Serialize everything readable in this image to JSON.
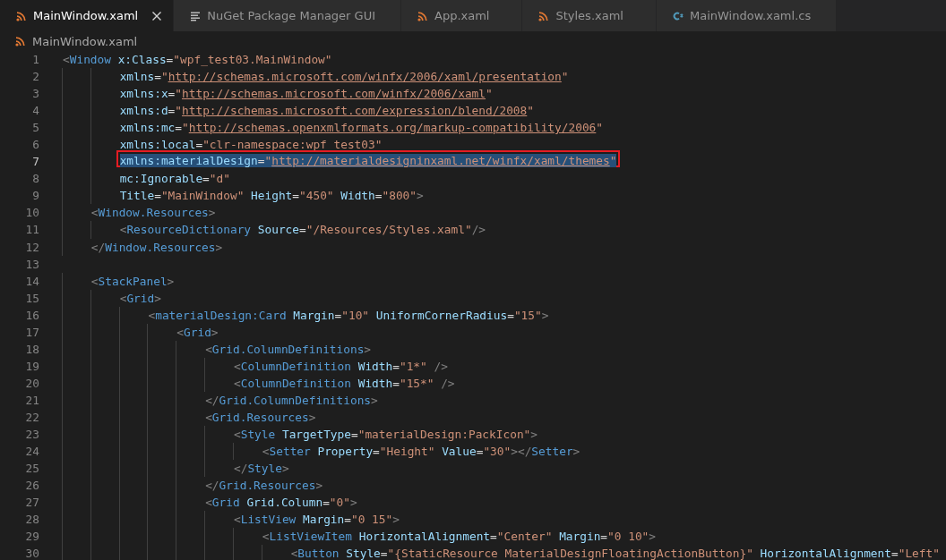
{
  "tabs": [
    {
      "label": "MainWindow.xaml",
      "kind": "xaml",
      "selected": true
    },
    {
      "label": "NuGet Package Manager GUI",
      "kind": "doc",
      "selected": false
    },
    {
      "label": "App.xaml",
      "kind": "xaml",
      "selected": false
    },
    {
      "label": "Styles.xaml",
      "kind": "xaml",
      "selected": false
    },
    {
      "label": "MainWindow.xaml.cs",
      "kind": "cs",
      "selected": false
    }
  ],
  "breadcrumb": {
    "label": "MainWindow.xaml",
    "kind": "xaml"
  },
  "lines": [
    {
      "number": "1",
      "selected": false,
      "tokens": [
        {
          "kind": "p",
          "text": "<"
        },
        {
          "kind": "tag",
          "text": "Window"
        },
        {
          "kind": "attr",
          "text": " x:Class"
        },
        {
          "kind": "eq",
          "text": "="
        },
        {
          "kind": "str",
          "text": "\"wpf_test03.MainWindow\""
        }
      ]
    },
    {
      "number": "2",
      "selected": false,
      "tokens": [
        {
          "kind": "attr",
          "text": "        xmlns"
        },
        {
          "kind": "eq",
          "text": "="
        },
        {
          "kind": "str",
          "text": "\""
        },
        {
          "kind": "link",
          "text": "http://schemas.microsoft.com/winfx/2006/xaml/presentation"
        },
        {
          "kind": "str",
          "text": "\""
        }
      ]
    },
    {
      "number": "3",
      "selected": false,
      "tokens": [
        {
          "kind": "attr",
          "text": "        xmlns:x"
        },
        {
          "kind": "eq",
          "text": "="
        },
        {
          "kind": "str",
          "text": "\""
        },
        {
          "kind": "link",
          "text": "http://schemas.microsoft.com/winfx/2006/xaml"
        },
        {
          "kind": "str",
          "text": "\""
        }
      ]
    },
    {
      "number": "4",
      "selected": false,
      "tokens": [
        {
          "kind": "attr",
          "text": "        xmlns:d"
        },
        {
          "kind": "eq",
          "text": "="
        },
        {
          "kind": "str",
          "text": "\""
        },
        {
          "kind": "link",
          "text": "http://schemas.microsoft.com/expression/blend/2008"
        },
        {
          "kind": "str",
          "text": "\""
        }
      ]
    },
    {
      "number": "5",
      "selected": false,
      "tokens": [
        {
          "kind": "attr",
          "text": "        xmlns:mc"
        },
        {
          "kind": "eq",
          "text": "="
        },
        {
          "kind": "str",
          "text": "\""
        },
        {
          "kind": "link",
          "text": "http://schemas.openxmlformats.org/markup-compatibility/2006"
        },
        {
          "kind": "str",
          "text": "\""
        }
      ]
    },
    {
      "number": "6",
      "selected": false,
      "tokens": [
        {
          "kind": "attr",
          "text": "        xmlns:local"
        },
        {
          "kind": "eq",
          "text": "="
        },
        {
          "kind": "str",
          "text": "\"clr-namespace:wpf_test03\""
        }
      ]
    },
    {
      "number": "7",
      "selected": true,
      "boxed": true,
      "tokens": [
        {
          "kind": "attr",
          "text": "        xmlns:materialDesign"
        },
        {
          "kind": "eq",
          "text": "="
        },
        {
          "kind": "str",
          "text": "\""
        },
        {
          "kind": "link",
          "text": "http://materialdesigninxaml.net/winfx/xaml/themes"
        },
        {
          "kind": "str",
          "text": "\""
        }
      ]
    },
    {
      "number": "8",
      "selected": false,
      "tokens": [
        {
          "kind": "attr",
          "text": "        mc:Ignorable"
        },
        {
          "kind": "eq",
          "text": "="
        },
        {
          "kind": "str",
          "text": "\"d\""
        }
      ]
    },
    {
      "number": "9",
      "selected": false,
      "tokens": [
        {
          "kind": "attr",
          "text": "        Title"
        },
        {
          "kind": "eq",
          "text": "="
        },
        {
          "kind": "str",
          "text": "\"MainWindow\""
        },
        {
          "kind": "attr",
          "text": " Height"
        },
        {
          "kind": "eq",
          "text": "="
        },
        {
          "kind": "str",
          "text": "\"450\""
        },
        {
          "kind": "attr",
          "text": " Width"
        },
        {
          "kind": "eq",
          "text": "="
        },
        {
          "kind": "str",
          "text": "\"800\""
        },
        {
          "kind": "p",
          "text": ">"
        }
      ]
    },
    {
      "number": "10",
      "selected": false,
      "tokens": [
        {
          "kind": "p",
          "text": "    <"
        },
        {
          "kind": "tag",
          "text": "Window.Resources"
        },
        {
          "kind": "p",
          "text": ">"
        }
      ]
    },
    {
      "number": "11",
      "selected": false,
      "tokens": [
        {
          "kind": "p",
          "text": "        <"
        },
        {
          "kind": "tag",
          "text": "ResourceDictionary"
        },
        {
          "kind": "attr",
          "text": " Source"
        },
        {
          "kind": "eq",
          "text": "="
        },
        {
          "kind": "str",
          "text": "\"/Resources/Styles.xaml\""
        },
        {
          "kind": "p",
          "text": "/>"
        }
      ]
    },
    {
      "number": "12",
      "selected": false,
      "tokens": [
        {
          "kind": "p",
          "text": "    </"
        },
        {
          "kind": "tag",
          "text": "Window.Resources"
        },
        {
          "kind": "p",
          "text": ">"
        }
      ]
    },
    {
      "number": "13",
      "selected": false
    },
    {
      "number": "14",
      "selected": false,
      "tokens": [
        {
          "kind": "p",
          "text": "    <"
        },
        {
          "kind": "tag",
          "text": "StackPanel"
        },
        {
          "kind": "p",
          "text": ">"
        }
      ]
    },
    {
      "number": "15",
      "selected": false,
      "tokens": [
        {
          "kind": "p",
          "text": "        <"
        },
        {
          "kind": "tag",
          "text": "Grid"
        },
        {
          "kind": "p",
          "text": ">"
        }
      ]
    },
    {
      "number": "16",
      "selected": false,
      "tokens": [
        {
          "kind": "p",
          "text": "            <"
        },
        {
          "kind": "tag",
          "text": "materialDesign:Card"
        },
        {
          "kind": "attr",
          "text": " Margin"
        },
        {
          "kind": "eq",
          "text": "="
        },
        {
          "kind": "str",
          "text": "\"10\""
        },
        {
          "kind": "attr",
          "text": " UniformCornerRadius"
        },
        {
          "kind": "eq",
          "text": "="
        },
        {
          "kind": "str",
          "text": "\"15\""
        },
        {
          "kind": "p",
          "text": ">"
        }
      ]
    },
    {
      "number": "17",
      "selected": false,
      "tokens": [
        {
          "kind": "p",
          "text": "                <"
        },
        {
          "kind": "tag",
          "text": "Grid"
        },
        {
          "kind": "p",
          "text": ">"
        }
      ]
    },
    {
      "number": "18",
      "selected": false,
      "tokens": [
        {
          "kind": "p",
          "text": "                    <"
        },
        {
          "kind": "tag",
          "text": "Grid.ColumnDefinitions"
        },
        {
          "kind": "p",
          "text": ">"
        }
      ]
    },
    {
      "number": "19",
      "selected": false,
      "tokens": [
        {
          "kind": "p",
          "text": "                        <"
        },
        {
          "kind": "tag",
          "text": "ColumnDefinition"
        },
        {
          "kind": "attr",
          "text": " Width"
        },
        {
          "kind": "eq",
          "text": "="
        },
        {
          "kind": "str",
          "text": "\"1*\""
        },
        {
          "kind": "p",
          "text": " />"
        }
      ]
    },
    {
      "number": "20",
      "selected": false,
      "tokens": [
        {
          "kind": "p",
          "text": "                        <"
        },
        {
          "kind": "tag",
          "text": "ColumnDefinition"
        },
        {
          "kind": "attr",
          "text": " Width"
        },
        {
          "kind": "eq",
          "text": "="
        },
        {
          "kind": "str",
          "text": "\"15*\""
        },
        {
          "kind": "p",
          "text": " />"
        }
      ]
    },
    {
      "number": "21",
      "selected": false,
      "tokens": [
        {
          "kind": "p",
          "text": "                    </"
        },
        {
          "kind": "tag",
          "text": "Grid.ColumnDefinitions"
        },
        {
          "kind": "p",
          "text": ">"
        }
      ]
    },
    {
      "number": "22",
      "selected": false,
      "tokens": [
        {
          "kind": "p",
          "text": "                    <"
        },
        {
          "kind": "tag",
          "text": "Grid.Resources"
        },
        {
          "kind": "p",
          "text": ">"
        }
      ]
    },
    {
      "number": "23",
      "selected": false,
      "tokens": [
        {
          "kind": "p",
          "text": "                        <"
        },
        {
          "kind": "tag",
          "text": "Style"
        },
        {
          "kind": "attr",
          "text": " TargetType"
        },
        {
          "kind": "eq",
          "text": "="
        },
        {
          "kind": "str",
          "text": "\"materialDesign:PackIcon\""
        },
        {
          "kind": "p",
          "text": ">"
        }
      ]
    },
    {
      "number": "24",
      "selected": false,
      "tokens": [
        {
          "kind": "p",
          "text": "                            <"
        },
        {
          "kind": "tag",
          "text": "Setter"
        },
        {
          "kind": "attr",
          "text": " Property"
        },
        {
          "kind": "eq",
          "text": "="
        },
        {
          "kind": "str",
          "text": "\"Height\""
        },
        {
          "kind": "attr",
          "text": " Value"
        },
        {
          "kind": "eq",
          "text": "="
        },
        {
          "kind": "str",
          "text": "\"30\""
        },
        {
          "kind": "p",
          "text": "></"
        },
        {
          "kind": "tag",
          "text": "Setter"
        },
        {
          "kind": "p",
          "text": ">"
        }
      ]
    },
    {
      "number": "25",
      "selected": false,
      "tokens": [
        {
          "kind": "p",
          "text": "                        </"
        },
        {
          "kind": "tag",
          "text": "Style"
        },
        {
          "kind": "p",
          "text": ">"
        }
      ]
    },
    {
      "number": "26",
      "selected": false,
      "tokens": [
        {
          "kind": "p",
          "text": "                    </"
        },
        {
          "kind": "tag",
          "text": "Grid.Resources"
        },
        {
          "kind": "p",
          "text": ">"
        }
      ]
    },
    {
      "number": "27",
      "selected": false,
      "tokens": [
        {
          "kind": "p",
          "text": "                    <"
        },
        {
          "kind": "tag",
          "text": "Grid"
        },
        {
          "kind": "attr",
          "text": " Grid.Column"
        },
        {
          "kind": "eq",
          "text": "="
        },
        {
          "kind": "str",
          "text": "\"0\""
        },
        {
          "kind": "p",
          "text": ">"
        }
      ]
    },
    {
      "number": "28",
      "selected": false,
      "tokens": [
        {
          "kind": "p",
          "text": "                        <"
        },
        {
          "kind": "tag",
          "text": "ListView"
        },
        {
          "kind": "attr",
          "text": " Margin"
        },
        {
          "kind": "eq",
          "text": "="
        },
        {
          "kind": "str",
          "text": "\"0 15\""
        },
        {
          "kind": "p",
          "text": ">"
        }
      ]
    },
    {
      "number": "29",
      "selected": false,
      "tokens": [
        {
          "kind": "p",
          "text": "                            <"
        },
        {
          "kind": "tag",
          "text": "ListViewItem"
        },
        {
          "kind": "attr",
          "text": " HorizontalAlignment"
        },
        {
          "kind": "eq",
          "text": "="
        },
        {
          "kind": "str",
          "text": "\"Center\""
        },
        {
          "kind": "attr",
          "text": " Margin"
        },
        {
          "kind": "eq",
          "text": "="
        },
        {
          "kind": "str",
          "text": "\"0 10\""
        },
        {
          "kind": "p",
          "text": ">"
        }
      ]
    },
    {
      "number": "30",
      "selected": false,
      "tokens": [
        {
          "kind": "p",
          "text": "                                <"
        },
        {
          "kind": "tag",
          "text": "Button"
        },
        {
          "kind": "attr",
          "text": " Style"
        },
        {
          "kind": "eq",
          "text": "="
        },
        {
          "kind": "str",
          "text": "\"{StaticResource MaterialDesignFloatingActionButton}\""
        },
        {
          "kind": "attr",
          "text": " HorizontalAlignment"
        },
        {
          "kind": "eq",
          "text": "="
        },
        {
          "kind": "str",
          "text": "\"Left\""
        }
      ]
    }
  ]
}
